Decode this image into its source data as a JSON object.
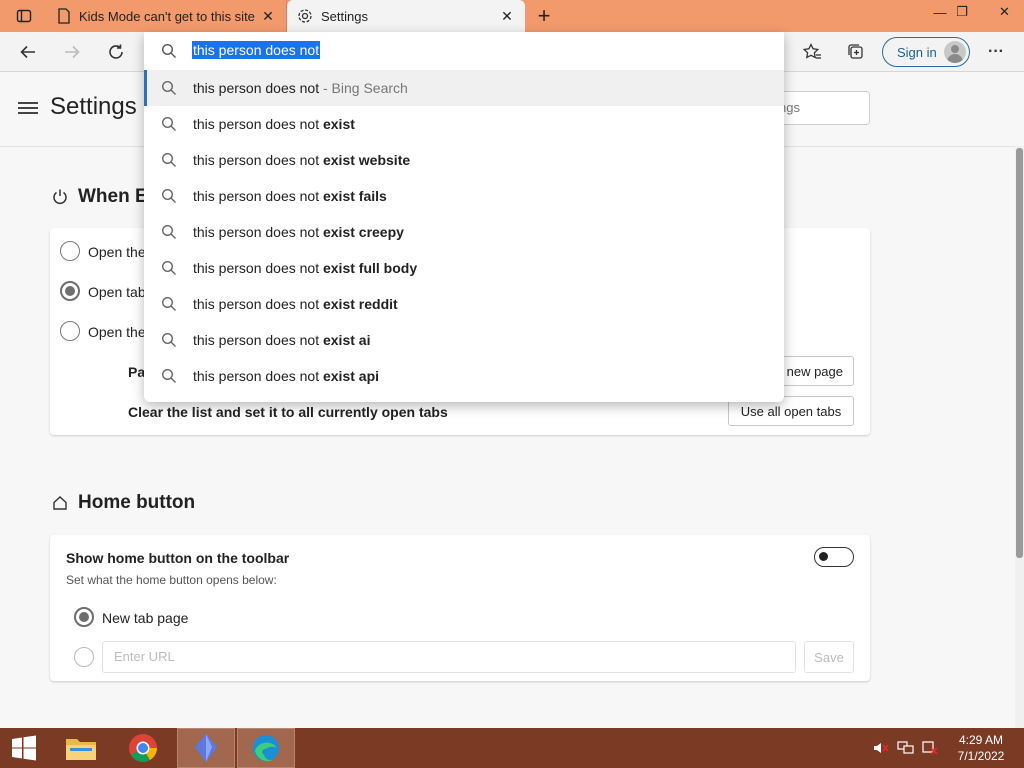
{
  "browser": {
    "tabs": [
      {
        "title": "Kids Mode can't get to this site",
        "close": "✕"
      },
      {
        "title": "Settings",
        "close": "✕"
      }
    ],
    "new_tab": "+",
    "window_controls": {
      "minimize": "—",
      "maximize": "❐",
      "close": "✕"
    },
    "sign_in_label": "Sign in",
    "more_label": "···"
  },
  "omnibox": {
    "typed_text": "this person does not",
    "suggestions": [
      {
        "prefix": "this person does not",
        "bold": "",
        "suffix": " - Bing Search"
      },
      {
        "prefix": "this person does not ",
        "bold": "exist",
        "suffix": ""
      },
      {
        "prefix": "this person does not ",
        "bold": "exist website",
        "suffix": ""
      },
      {
        "prefix": "this person does not ",
        "bold": "exist fails",
        "suffix": ""
      },
      {
        "prefix": "this person does not ",
        "bold": "exist creepy",
        "suffix": ""
      },
      {
        "prefix": "this person does not ",
        "bold": "exist full body",
        "suffix": ""
      },
      {
        "prefix": "this person does not ",
        "bold": "exist reddit",
        "suffix": ""
      },
      {
        "prefix": "this person does not ",
        "bold": "exist ai",
        "suffix": ""
      },
      {
        "prefix": "this person does not ",
        "bold": "exist api",
        "suffix": ""
      }
    ]
  },
  "settings": {
    "title": "Settings",
    "search_placeholder": "ngs",
    "startup": {
      "title": "When E",
      "options": [
        "Open the",
        "Open tab",
        "Open the"
      ],
      "pages_label": "Pa",
      "add_page_button": "new page",
      "clear_label": "Clear the list and set it to all currently open tabs",
      "use_open_tabs_button": "Use all open tabs"
    },
    "home": {
      "title": "Home button",
      "show_label": "Show home button on the toolbar",
      "sub_label": "Set what the home button opens below:",
      "option_new_tab": "New tab page",
      "url_placeholder": "Enter URL",
      "save_button": "Save"
    }
  },
  "taskbar": {
    "time": "4:29 AM",
    "date": "7/1/2022"
  }
}
